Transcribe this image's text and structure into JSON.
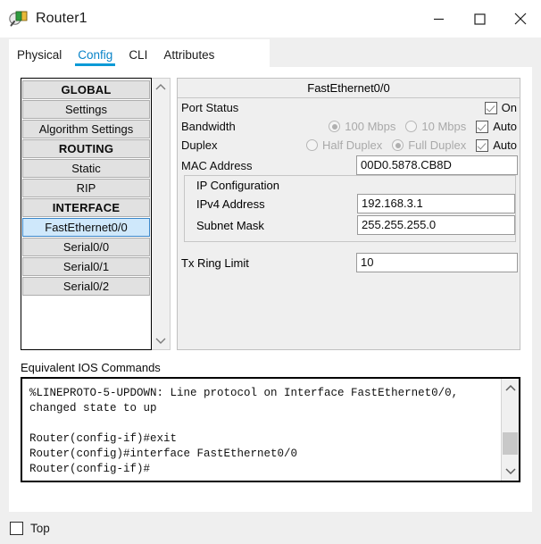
{
  "window": {
    "title": "Router1",
    "icon": "router-device-icon",
    "controls": {
      "minimize": "minimize-icon",
      "maximize": "maximize-icon",
      "close": "close-icon"
    }
  },
  "tabs": [
    {
      "label": "Physical",
      "active": false
    },
    {
      "label": "Config",
      "active": true
    },
    {
      "label": "CLI",
      "active": false
    },
    {
      "label": "Attributes",
      "active": false
    }
  ],
  "sidebar": {
    "items": [
      {
        "label": "GLOBAL",
        "kind": "header",
        "selected": false
      },
      {
        "label": "Settings",
        "kind": "item",
        "selected": false
      },
      {
        "label": "Algorithm Settings",
        "kind": "item",
        "selected": false
      },
      {
        "label": "ROUTING",
        "kind": "header",
        "selected": false
      },
      {
        "label": "Static",
        "kind": "item",
        "selected": false
      },
      {
        "label": "RIP",
        "kind": "item",
        "selected": false
      },
      {
        "label": "INTERFACE",
        "kind": "header",
        "selected": false
      },
      {
        "label": "FastEthernet0/0",
        "kind": "item",
        "selected": true
      },
      {
        "label": "Serial0/0",
        "kind": "item",
        "selected": false
      },
      {
        "label": "Serial0/1",
        "kind": "item",
        "selected": false
      },
      {
        "label": "Serial0/2",
        "kind": "item",
        "selected": false
      }
    ],
    "scrollbar": {
      "up": "chevron-up-icon",
      "down": "chevron-down-icon"
    }
  },
  "config": {
    "title": "FastEthernet0/0",
    "port_status": {
      "label": "Port Status",
      "checkbox_label": "On",
      "checked": true
    },
    "bandwidth": {
      "label": "Bandwidth",
      "options": [
        {
          "label": "100 Mbps",
          "selected": true
        },
        {
          "label": "10 Mbps",
          "selected": false
        }
      ],
      "auto_label": "Auto",
      "auto_checked": true
    },
    "duplex": {
      "label": "Duplex",
      "options": [
        {
          "label": "Half Duplex",
          "selected": false
        },
        {
          "label": "Full Duplex",
          "selected": true
        }
      ],
      "auto_label": "Auto",
      "auto_checked": true
    },
    "mac_address": {
      "label": "MAC Address",
      "value": "00D0.5878.CB8D"
    },
    "ip_configuration": {
      "group_label": "IP Configuration",
      "ipv4": {
        "label": "IPv4 Address",
        "value": "192.168.3.1"
      },
      "subnet": {
        "label": "Subnet Mask",
        "value": "255.255.255.0"
      }
    },
    "tx_ring_limit": {
      "label": "Tx Ring Limit",
      "value": "10"
    }
  },
  "ios": {
    "label": "Equivalent IOS Commands",
    "text": "%LINEPROTO-5-UPDOWN: Line protocol on Interface FastEthernet0/0,\nchanged state to up\n\nRouter(config-if)#exit\nRouter(config)#interface FastEthernet0/0\nRouter(config-if)#",
    "scrollbar": {
      "up": "chevron-up-icon",
      "down": "chevron-down-icon"
    }
  },
  "bottom": {
    "top_checkbox": {
      "label": "Top",
      "checked": false
    }
  },
  "colors": {
    "accent": "#0a9ad6",
    "selected_item_bg": "#cfe8fb",
    "selected_item_border": "#3a86c8",
    "panel_bg": "#efefef",
    "card_bg": "#ffffff"
  }
}
